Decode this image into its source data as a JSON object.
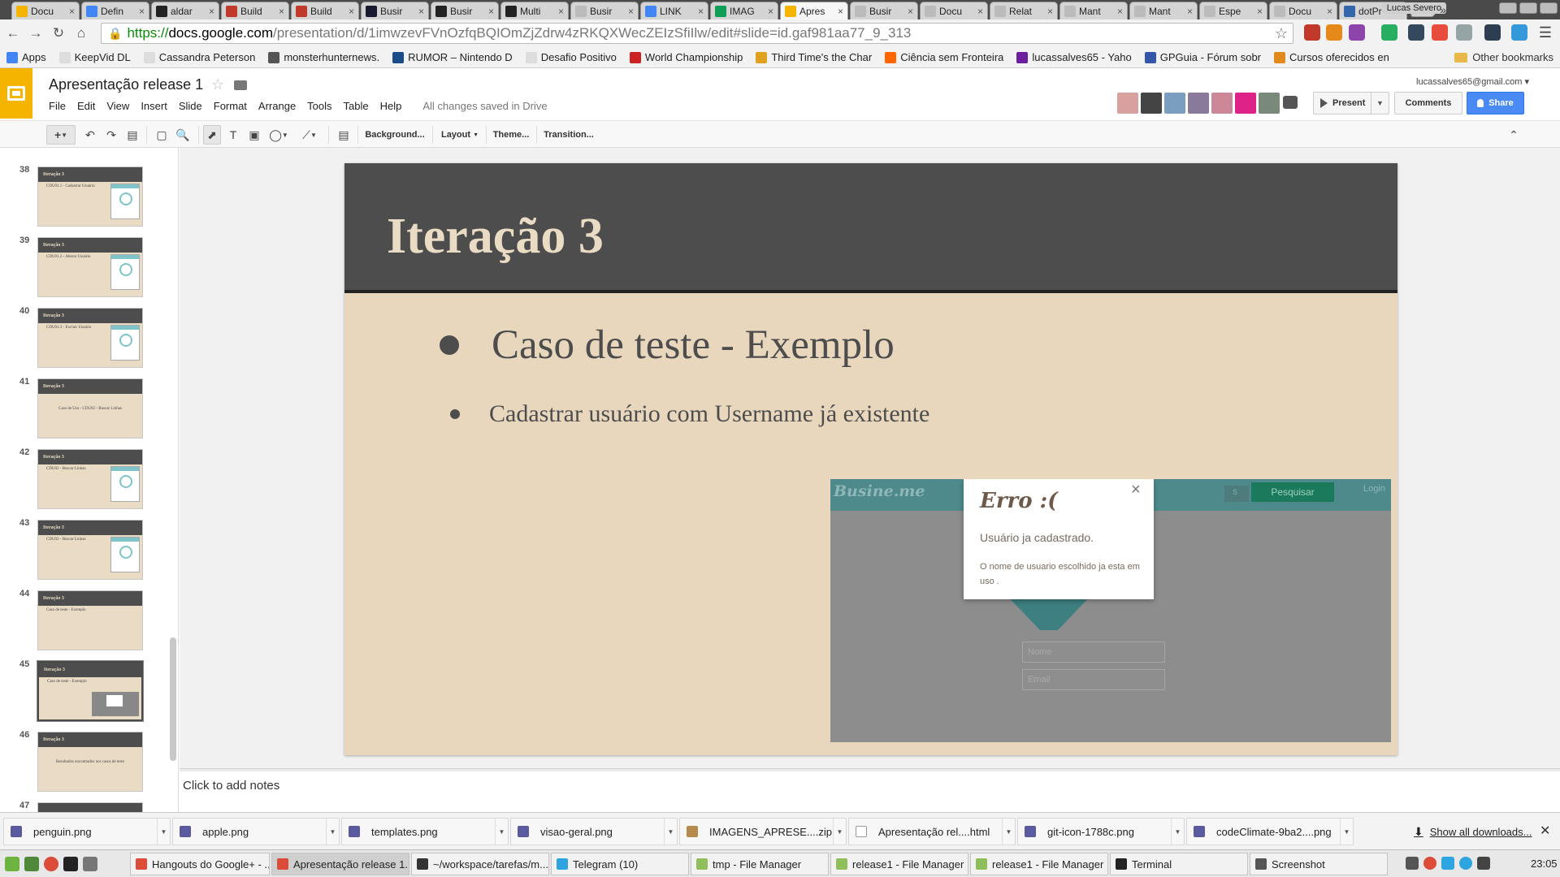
{
  "browser": {
    "tabs": [
      {
        "label": "Docu",
        "icon": "google-drive-icon",
        "color": "#f4b400"
      },
      {
        "label": "Defin",
        "icon": "google-icon",
        "color": "#4285f4"
      },
      {
        "label": "aldar",
        "icon": "github-icon",
        "color": "#222222"
      },
      {
        "label": "Build",
        "icon": "build-icon",
        "color": "#c0392b"
      },
      {
        "label": "Build",
        "icon": "build-icon",
        "color": "#c0392b"
      },
      {
        "label": "Busir",
        "icon": "star-icon",
        "color": "#1a1a2e"
      },
      {
        "label": "Busir",
        "icon": "github-icon",
        "color": "#222222"
      },
      {
        "label": "Multi",
        "icon": "github-icon",
        "color": "#222222"
      },
      {
        "label": "Busir",
        "icon": "page-icon",
        "color": "#bbbbbb"
      },
      {
        "label": "LINK",
        "icon": "docs-icon",
        "color": "#4285f4"
      },
      {
        "label": "IMAG",
        "icon": "drive-icon",
        "color": "#0f9d58"
      },
      {
        "label": "Apres",
        "icon": "slides-icon",
        "color": "#f4b400",
        "active": true
      },
      {
        "label": "Busir",
        "icon": "page-icon",
        "color": "#bbbbbb"
      },
      {
        "label": "Docu",
        "icon": "page-icon",
        "color": "#bbbbbb"
      },
      {
        "label": "Relat",
        "icon": "page-icon",
        "color": "#bbbbbb"
      },
      {
        "label": "Mant",
        "icon": "page-icon",
        "color": "#bbbbbb"
      },
      {
        "label": "Mant",
        "icon": "page-icon",
        "color": "#bbbbbb"
      },
      {
        "label": "Espe",
        "icon": "page-icon",
        "color": "#bbbbbb"
      },
      {
        "label": "Docu",
        "icon": "page-icon",
        "color": "#bbbbbb"
      },
      {
        "label": "dotPr",
        "icon": "dotpr-icon",
        "color": "#3366aa"
      }
    ],
    "profile_name": "Lucas Severo",
    "url": {
      "scheme": "https://",
      "host": "docs.google.com",
      "path": "/presentation/d/1imwzevFVnOzfqBQIOmZjZdrw4zRKQXWecZEIzSfiIlw/edit#slide=id.gaf981aa77_9_313"
    },
    "bookmarks": [
      {
        "label": "Apps",
        "color": "#4285f4"
      },
      {
        "label": "KeepVid DL",
        "color": "#dddddd"
      },
      {
        "label": "Cassandra Peterson",
        "color": "#dddddd"
      },
      {
        "label": "monsterhunternews.",
        "color": "#555555"
      },
      {
        "label": "RUMOR – Nintendo D",
        "color": "#1a4c8c"
      },
      {
        "label": "Desafio Positivo",
        "color": "#dddddd"
      },
      {
        "label": "World Championship",
        "color": "#cc2222"
      },
      {
        "label": "Third Time's the Char",
        "color": "#e0a020"
      },
      {
        "label": "Ciência sem Fronteira",
        "color": "#ff6600"
      },
      {
        "label": "lucassalves65 - Yaho",
        "color": "#6b1f9c"
      },
      {
        "label": "GPGuia - Fórum sobr",
        "color": "#3355aa"
      },
      {
        "label": "Cursos oferecidos en",
        "color": "#e08a1e"
      }
    ],
    "other_bookmarks": "Other bookmarks",
    "overflow_chevron": "»"
  },
  "docs": {
    "title": "Apresentação release 1",
    "account": "lucassalves65@gmail.com",
    "menus": [
      "File",
      "Edit",
      "View",
      "Insert",
      "Slide",
      "Format",
      "Arrange",
      "Tools",
      "Table",
      "Help"
    ],
    "save_status": "All changes saved in Drive",
    "present_label": "Present",
    "comments_label": "Comments",
    "share_label": "Share",
    "collaborator_colors": [
      "#d9a0a0",
      "#444444",
      "#7a9ec0",
      "#8a7a9a",
      "#cc8899",
      "#dd2288",
      "#7a8a7a"
    ],
    "toolbar": {
      "background": "Background...",
      "layout": "Layout",
      "theme": "Theme...",
      "transition": "Transition..."
    },
    "notes_placeholder": "Click to add notes"
  },
  "filmstrip": [
    {
      "num": "38",
      "header": "Iteração 3",
      "line": "CDU01.1 - Cadastrar Usuário",
      "kind": "shot"
    },
    {
      "num": "39",
      "header": "Iteração 3",
      "line": "CDU01.2 - Alterar Usuário",
      "kind": "shot"
    },
    {
      "num": "40",
      "header": "Iteração 3",
      "line": "CDU01.3 - Excluir Usuário",
      "kind": "shot"
    },
    {
      "num": "41",
      "header": "Iteração 3",
      "line": "Caso de Uso - CDU02 - Buscar Linhas",
      "kind": "center"
    },
    {
      "num": "42",
      "header": "Iteração 3",
      "line": "CDU02 - Buscar Linhas",
      "kind": "shot"
    },
    {
      "num": "43",
      "header": "Iteração 3",
      "line": "CDU02 - Buscar Linhas",
      "kind": "shot"
    },
    {
      "num": "44",
      "header": "Iteração 3",
      "line": "Caso de teste - Exemplo",
      "kind": "text"
    },
    {
      "num": "45",
      "header": "Iteração 3",
      "line": "Caso de teste - Exemplo",
      "kind": "shot2",
      "selected": true
    },
    {
      "num": "46",
      "header": "Iteração 3",
      "line": "Resultados encontrados nos casos de teste",
      "kind": "center"
    },
    {
      "num": "47",
      "header": "",
      "line": "",
      "kind": "blank"
    }
  ],
  "slide": {
    "title": "Iteração 3",
    "bullet_main": "Caso de teste - Exemplo",
    "bullet_sub": "Cadastrar usuário com Username já existente",
    "embedded": {
      "logo": "Busine.me",
      "search_button": "Pesquisar",
      "partial_label": "s",
      "login_link": "Login",
      "dialog_title": "Erro :(",
      "dialog_message": "Usuário ja cadastrado.",
      "dialog_detail": "O nome de usuario escolhido ja esta em uso .",
      "dialog_close": "×",
      "name_placeholder": "Nome",
      "email_placeholder": "Email"
    }
  },
  "downloads": [
    {
      "name": "penguin.png",
      "type": "png"
    },
    {
      "name": "apple.png",
      "type": "png"
    },
    {
      "name": "templates.png",
      "type": "png"
    },
    {
      "name": "visao-geral.png",
      "type": "png"
    },
    {
      "name": "IMAGENS_APRESE....zip",
      "type": "zip"
    },
    {
      "name": "Apresentação rel....html",
      "type": "html"
    },
    {
      "name": "git-icon-1788c.png",
      "type": "png"
    },
    {
      "name": "codeClimate-9ba2....png",
      "type": "png"
    }
  ],
  "show_all_downloads": "Show all downloads...",
  "taskbar": {
    "tasks": [
      {
        "label": "Hangouts do Google+ - ...",
        "color": "#dd4b39"
      },
      {
        "label": "Apresentação release 1...",
        "color": "#dd4b39",
        "active": true
      },
      {
        "label": "~/workspace/tarefas/m...",
        "color": "#333333"
      },
      {
        "label": "Telegram (10)",
        "color": "#2ca5e0"
      },
      {
        "label": "tmp - File Manager",
        "color": "#8fbf5a"
      },
      {
        "label": "release1 - File Manager",
        "color": "#8fbf5a"
      },
      {
        "label": "release1 - File Manager",
        "color": "#8fbf5a"
      },
      {
        "label": "Terminal",
        "color": "#222222"
      },
      {
        "label": "Screenshot",
        "color": "#555555"
      }
    ],
    "clock": "23:05"
  }
}
